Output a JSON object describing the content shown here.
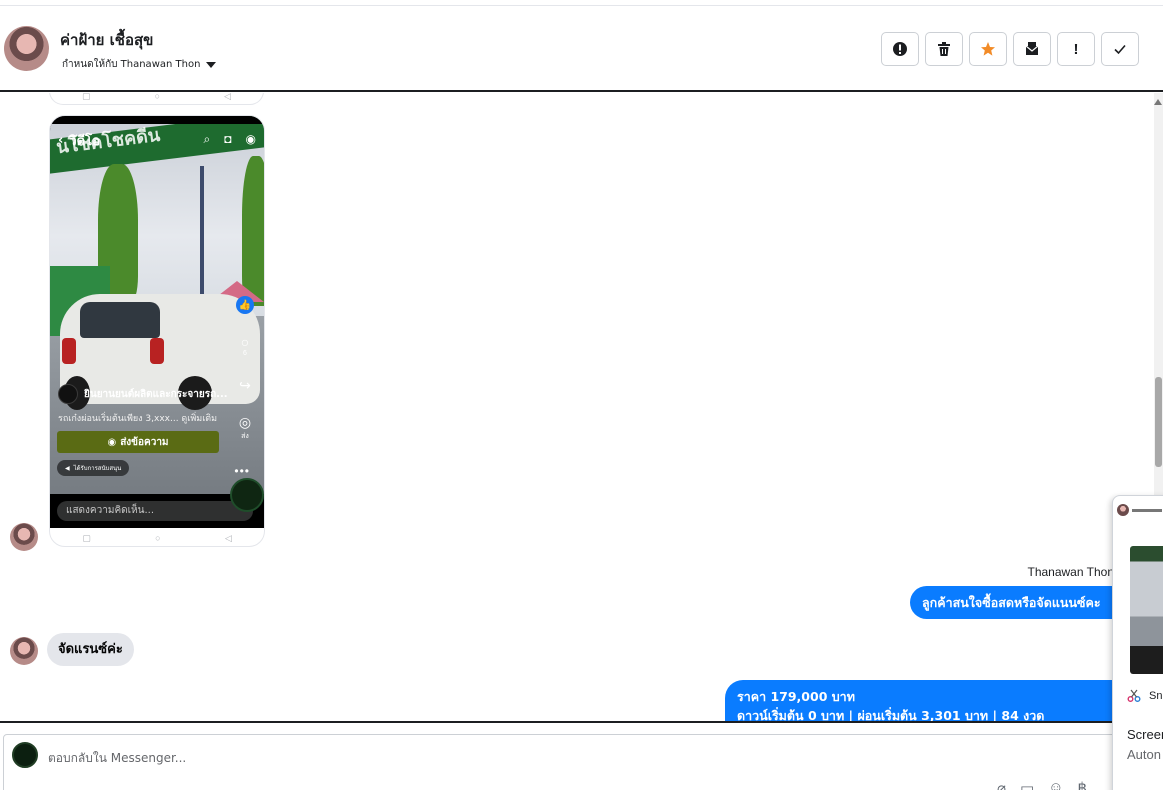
{
  "header": {
    "contact_name": "ค่าฝ้าย เชื้อสุข",
    "assigned_to": "กำหนดให้กับ Thanawan Thon",
    "actions": [
      {
        "icon": "alert-circle-icon",
        "name": "report-button"
      },
      {
        "icon": "trash-icon",
        "name": "delete-button"
      },
      {
        "icon": "star-icon",
        "name": "star-button",
        "color": "#f28b27"
      },
      {
        "icon": "mark-unread-icon",
        "name": "mark-unread-button"
      },
      {
        "icon": "exclamation-icon",
        "name": "spam-button"
      },
      {
        "icon": "check-icon",
        "name": "done-button"
      }
    ]
  },
  "phone_screenshot": {
    "top_title": "วิดีโอ",
    "banner_text": "นโชคโชคดีน",
    "page_name": "ยินยานยนต์ผลิตและกระจายรถ...",
    "caption": "รถเก๋งผ่อนเริ่มต้นเพียง 3,xxx... ดูเพิ่มเติม",
    "send_button": "ส่งข้อความ",
    "ad_label": "ได้รับการสนับสนุน",
    "comment_placeholder": "แสดงความคิดเห็น...",
    "comment_count": "6",
    "share_label": "ส่ง"
  },
  "messages": {
    "sender_name": "Thanawan Thon",
    "outgoing_1": "ลูกค้าสนใจซื้อสดหรือจัดแนนซ์คะ",
    "incoming_1": "จัดแรนซ์ค่ะ",
    "outgoing_2_line1": "ราคา 179,000 บาท",
    "outgoing_2_line2": "ดาวน์เริ่มต้น 0 บาท | ผ่อนเริ่มต้น 3,301 บาท | 84 งวด"
  },
  "composer": {
    "placeholder": "ตอบกลับใน Messenger..."
  },
  "snip_popup": {
    "app_label": "Sn",
    "title": "Screen",
    "subtitle": "Auton"
  },
  "colors": {
    "accent_blue": "#0a7cff",
    "incoming_gray": "#e4e6eb",
    "star_orange": "#f28b27",
    "send_green": "#5a6b14"
  }
}
